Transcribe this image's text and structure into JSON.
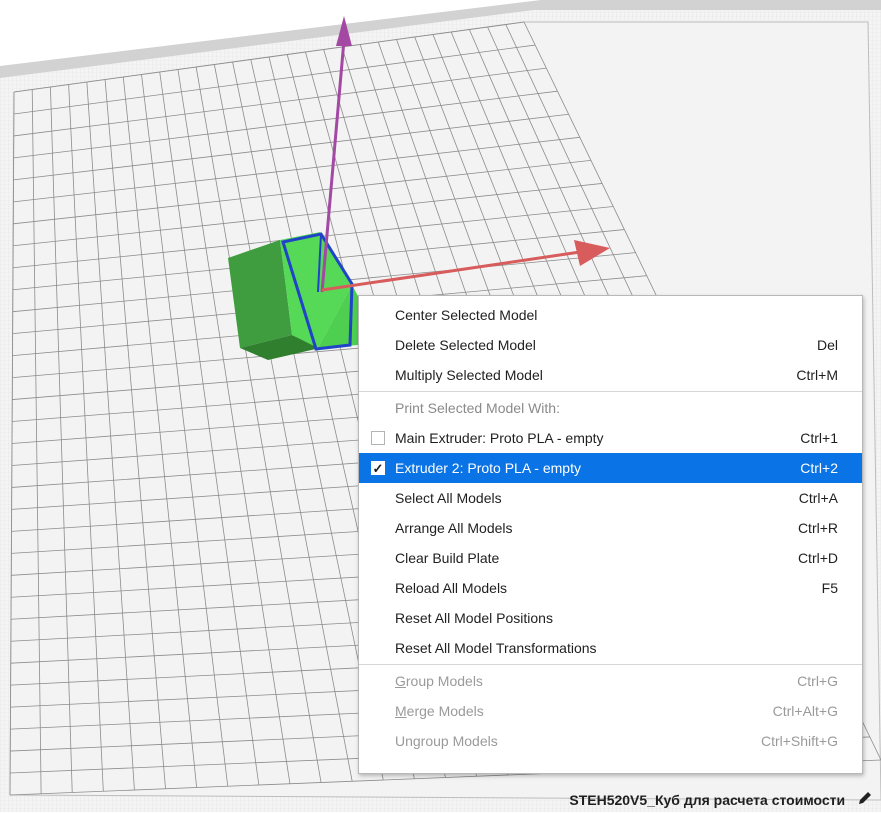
{
  "context_menu": {
    "items": [
      {
        "label": "Center Selected Model",
        "shortcut": ""
      },
      {
        "label": "Delete Selected Model",
        "shortcut": "Del"
      },
      {
        "label": "Multiply Selected Model",
        "shortcut": "Ctrl+M"
      }
    ],
    "extruder_header": "Print Selected Model With:",
    "extruders": [
      {
        "label": "Main Extruder: Proto PLA - empty",
        "shortcut": "Ctrl+1",
        "checked": false
      },
      {
        "label": "Extruder 2: Proto PLA - empty",
        "shortcut": "Ctrl+2",
        "checked": true
      }
    ],
    "global_items": [
      {
        "label": "Select All Models",
        "shortcut": "Ctrl+A"
      },
      {
        "label": "Arrange All Models",
        "shortcut": "Ctrl+R"
      },
      {
        "label": "Clear Build Plate",
        "shortcut": "Ctrl+D"
      },
      {
        "label": "Reload All Models",
        "shortcut": "F5"
      },
      {
        "label": "Reset All Model Positions",
        "shortcut": ""
      },
      {
        "label": "Reset All Model Transformations",
        "shortcut": ""
      }
    ],
    "group_items": [
      {
        "mnemonic": "G",
        "rest": "roup Models",
        "shortcut": "Ctrl+G"
      },
      {
        "mnemonic": "M",
        "rest": "erge Models",
        "shortcut": "Ctrl+Alt+G"
      },
      {
        "mnemonic": "",
        "rest": "Ungroup Models",
        "shortcut": "Ctrl+Shift+G"
      }
    ]
  },
  "status_bar": {
    "job_name": "STEH520V5_Куб для расчета стоимости",
    "edit_icon": "pencil-icon"
  },
  "colors": {
    "plate": "#f2f2f2",
    "grid": "#8c8c8c",
    "border": "#cfcfcf",
    "model": "#4fdc4f",
    "model_dark": "#3c9a3c",
    "selection": "#1f44c8",
    "axis_y": "#a349a4",
    "axis_x": "#d85c5c",
    "menu_highlight": "#0a73e6"
  }
}
